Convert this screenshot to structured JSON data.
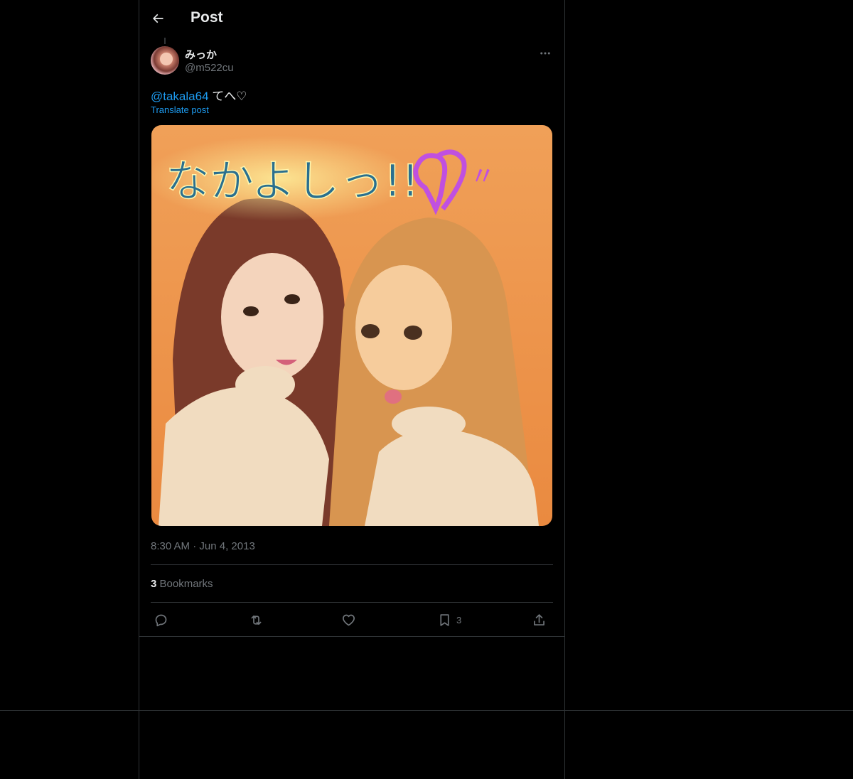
{
  "header": {
    "title": "Post"
  },
  "post": {
    "display_name": "みっか",
    "handle": "@m522cu",
    "mention": "@takala64",
    "text": " てへ♡",
    "translate_label": "Translate post",
    "image_caption": "なかよしっ!!",
    "image_mark": "〃",
    "time": "8:30 AM",
    "separator": "·",
    "date": "Jun 4, 2013",
    "bookmarks_count": "3",
    "bookmarks_label": "Bookmarks"
  },
  "actions": {
    "reply": {
      "icon": "reply-icon"
    },
    "repost": {
      "icon": "repost-icon"
    },
    "like": {
      "icon": "heart-icon"
    },
    "bookmark": {
      "icon": "bookmark-icon",
      "count": "3"
    },
    "share": {
      "icon": "share-icon"
    }
  },
  "colors": {
    "background": "#000000",
    "text": "#e7e9ea",
    "muted": "#71767b",
    "accent": "#1d9bf0",
    "border": "#2f3336"
  }
}
